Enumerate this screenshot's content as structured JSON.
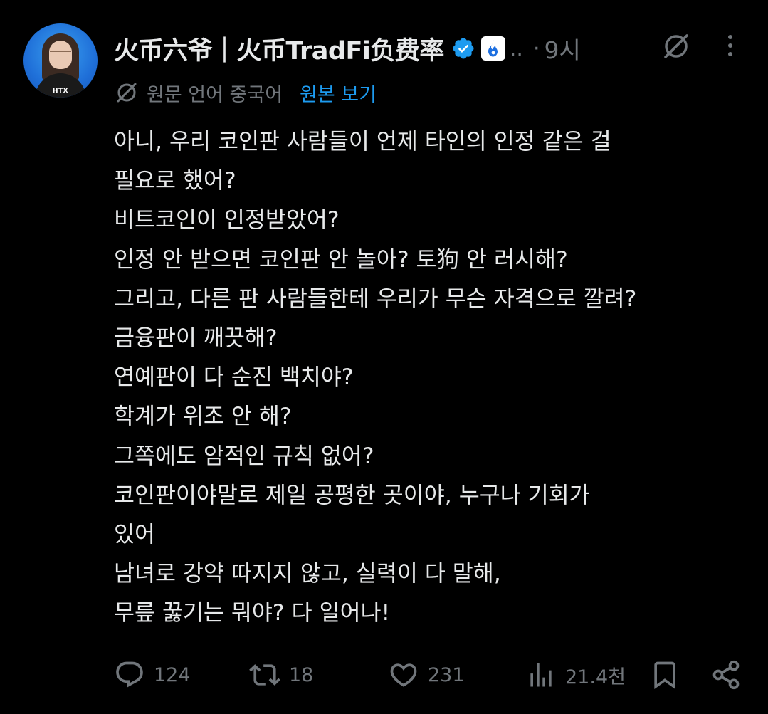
{
  "author": {
    "display_name": "火币六爷｜火币TradFi负费率",
    "truncation": "..",
    "time_separator": "·",
    "time": "9시",
    "avatar_brand": "HTX"
  },
  "translation": {
    "label": "원문 언어 중국어",
    "show_original": "원본 보기"
  },
  "body_lines": [
    "아니, 우리 코인판 사람들이 언제 타인의 인정 같은 걸",
    "필요로 했어?",
    "비트코인이 인정받았어?",
    "인정 안 받으면 코인판 안 놀아? 토狗 안 러시해?",
    "그리고, 다른 판 사람들한테 우리가 무슨 자격으로 깔려?",
    "금융판이 깨끗해?",
    "연예판이 다 순진 백치야?",
    "학계가 위조 안 해?",
    "그쪽에도 암적인 규칙 없어?",
    "코인판이야말로 제일 공평한 곳이야, 누구나 기회가",
    "있어",
    "남녀로 강약 따지지 않고, 실력이 다 말해,",
    "무릎 꿇기는 뭐야? 다 일어나!"
  ],
  "actions": {
    "reply_count": "124",
    "retweet_count": "18",
    "like_count": "231",
    "view_count": "21.4천"
  },
  "colors": {
    "background": "#000000",
    "text": "#e7e9ea",
    "muted": "#71767b",
    "accent": "#1d9bf0"
  },
  "icons": {
    "verified": "verified-badge-icon",
    "affiliation": "htx-flame-icon",
    "grok": "grok-icon",
    "more": "more-vertical-icon",
    "translate": "translate-icon",
    "reply": "reply-icon",
    "retweet": "retweet-icon",
    "like": "heart-icon",
    "views": "analytics-icon",
    "bookmark": "bookmark-icon",
    "share": "share-icon"
  }
}
